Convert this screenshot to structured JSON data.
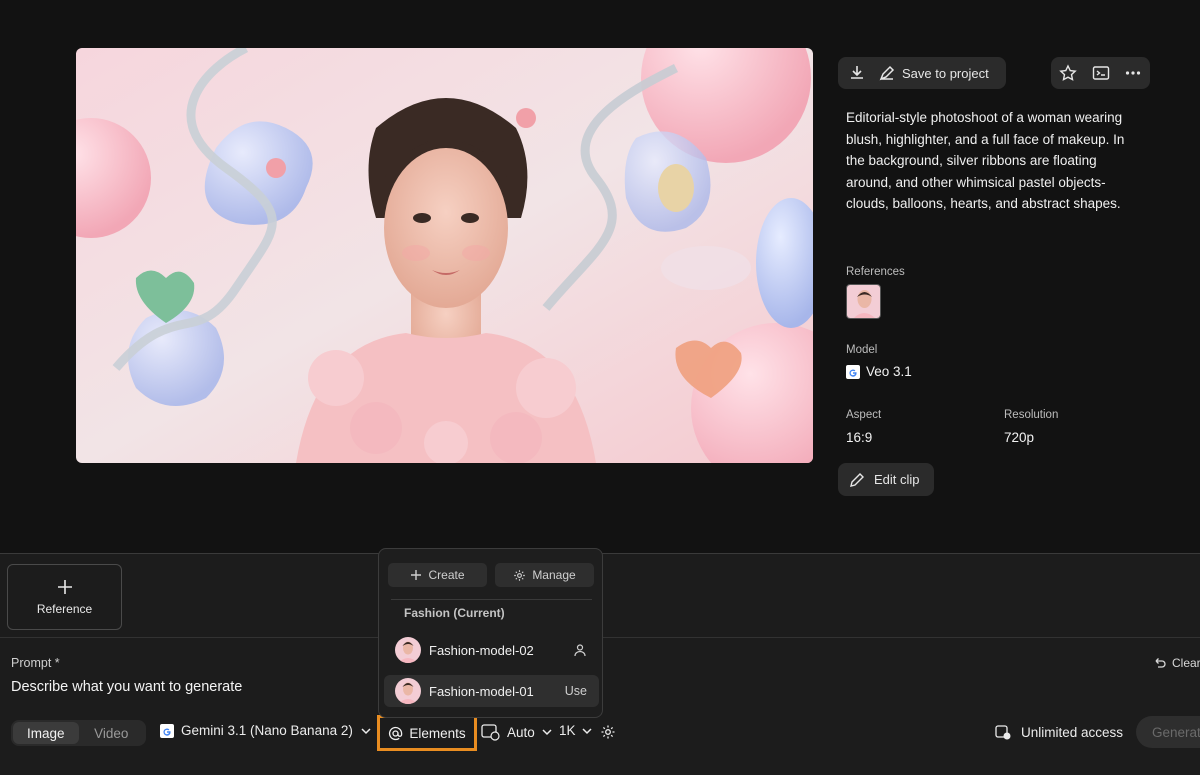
{
  "header": {
    "save_label": "Save to project"
  },
  "description": "Editorial-style photoshoot of a woman wearing blush, highlighter, and a full face of makeup. In the background, silver ribbons are floating around, and other whimsical pastel objects- clouds, balloons, hearts, and abstract shapes.",
  "details": {
    "references_label": "References",
    "model_label": "Model",
    "model_value": "Veo 3.1",
    "aspect_label": "Aspect",
    "aspect_value": "16:9",
    "resolution_label": "Resolution",
    "resolution_value": "720p"
  },
  "edit_clip_label": "Edit clip",
  "composer": {
    "reference_label": "Reference",
    "prompt_label": "Prompt *",
    "prompt_placeholder": "Describe what you want to generate",
    "clear_label": "Clear",
    "mode_tabs": [
      "Image",
      "Video"
    ],
    "active_mode": "Image",
    "model": "Gemini 3.1 (Nano Banana 2)",
    "elements_label": "Elements",
    "aspect": "Auto",
    "resolution": "1K",
    "access_label": "Unlimited access",
    "generate_label": "Generate"
  },
  "elements_popover": {
    "create_label": "Create",
    "manage_label": "Manage",
    "group_label": "Fashion (Current)",
    "items": [
      {
        "name": "Fashion-model-02",
        "action_icon": "person-icon"
      },
      {
        "name": "Fashion-model-01",
        "action": "Use"
      }
    ]
  },
  "colors": {
    "background": "#121212",
    "panel": "#1c1c1c",
    "highlight_outline": "#e98d21"
  }
}
